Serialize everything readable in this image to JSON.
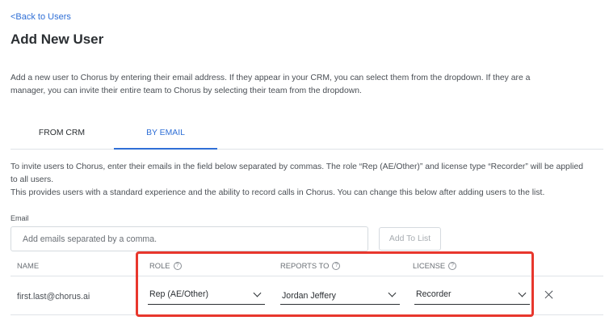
{
  "nav": {
    "back_label": "<Back to Users"
  },
  "page": {
    "title": "Add New User",
    "intro": "Add a new user to Chorus by entering their email address. If they appear in your CRM, you can select them from the dropdown. If they are a manager, you can invite their entire team to Chorus by selecting their team from the dropdown."
  },
  "tabs": [
    {
      "label": "FROM CRM",
      "active": false
    },
    {
      "label": "BY EMAIL",
      "active": true
    }
  ],
  "instructions": {
    "line1": "To invite users to Chorus, enter their emails in the field below separated by commas. The role “Rep (AE/Other)” and license type “Recorder” will be applied to all users.",
    "line2": "This provides users with a standard experience and the ability to record calls in Chorus. You can change this below after adding users to the list."
  },
  "form": {
    "email_label": "Email",
    "email_placeholder": "Add emails separated by a comma.",
    "add_button": "Add To List"
  },
  "table": {
    "headers": {
      "name": "NAME",
      "role": "ROLE",
      "reports_to": "REPORTS TO",
      "license": "LICENSE"
    },
    "rows": [
      {
        "email": "first.last@chorus.ai",
        "role": "Rep (AE/Other)",
        "reports_to": "Jordan Jeffery",
        "license": "Recorder"
      }
    ]
  },
  "icons": {
    "info": "info-circle-icon",
    "chevron": "chevron-down-icon",
    "close": "close-icon"
  },
  "colors": {
    "accent": "#2f6fd6",
    "highlight": "#e8372d",
    "divider": "#dfe3e8"
  }
}
